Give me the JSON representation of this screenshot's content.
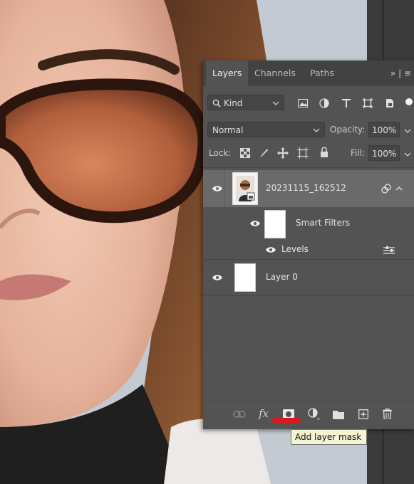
{
  "panel": {
    "tabs": [
      {
        "label": "Layers",
        "active": true
      },
      {
        "label": "Channels",
        "active": false
      },
      {
        "label": "Paths",
        "active": false
      }
    ],
    "menu_icon": "panel-menu-icon",
    "filter": {
      "kind_label": "Kind",
      "icons": [
        "image-filter-icon",
        "adjustment-filter-icon",
        "type-filter-icon",
        "shape-filter-icon",
        "smart-object-filter-icon"
      ]
    },
    "blend_mode": "Normal",
    "opacity_label": "Opacity:",
    "opacity_value": "100%",
    "lock_label": "Lock:",
    "fill_label": "Fill:",
    "fill_value": "100%",
    "layers": [
      {
        "name": "20231115_162512",
        "type": "smart-object",
        "visible": true,
        "selected": true
      },
      {
        "name": "Smart Filters",
        "type": "smart-filters",
        "visible": true
      },
      {
        "name": "Levels",
        "type": "filter",
        "visible": true
      },
      {
        "name": "Layer 0",
        "type": "pixel",
        "visible": true
      }
    ],
    "footer_icons": [
      "link-layers-icon",
      "fx-icon",
      "add-layer-mask-icon",
      "adjustment-layer-icon",
      "group-folder-icon",
      "new-layer-icon",
      "trash-icon"
    ]
  },
  "tooltip": {
    "text": "Add layer mask"
  },
  "colors": {
    "panel_bg": "#535353",
    "selected_row": "#6a6a6a",
    "highlight_mark": "#e0161d",
    "tooltip_bg": "#f5f3d2"
  }
}
